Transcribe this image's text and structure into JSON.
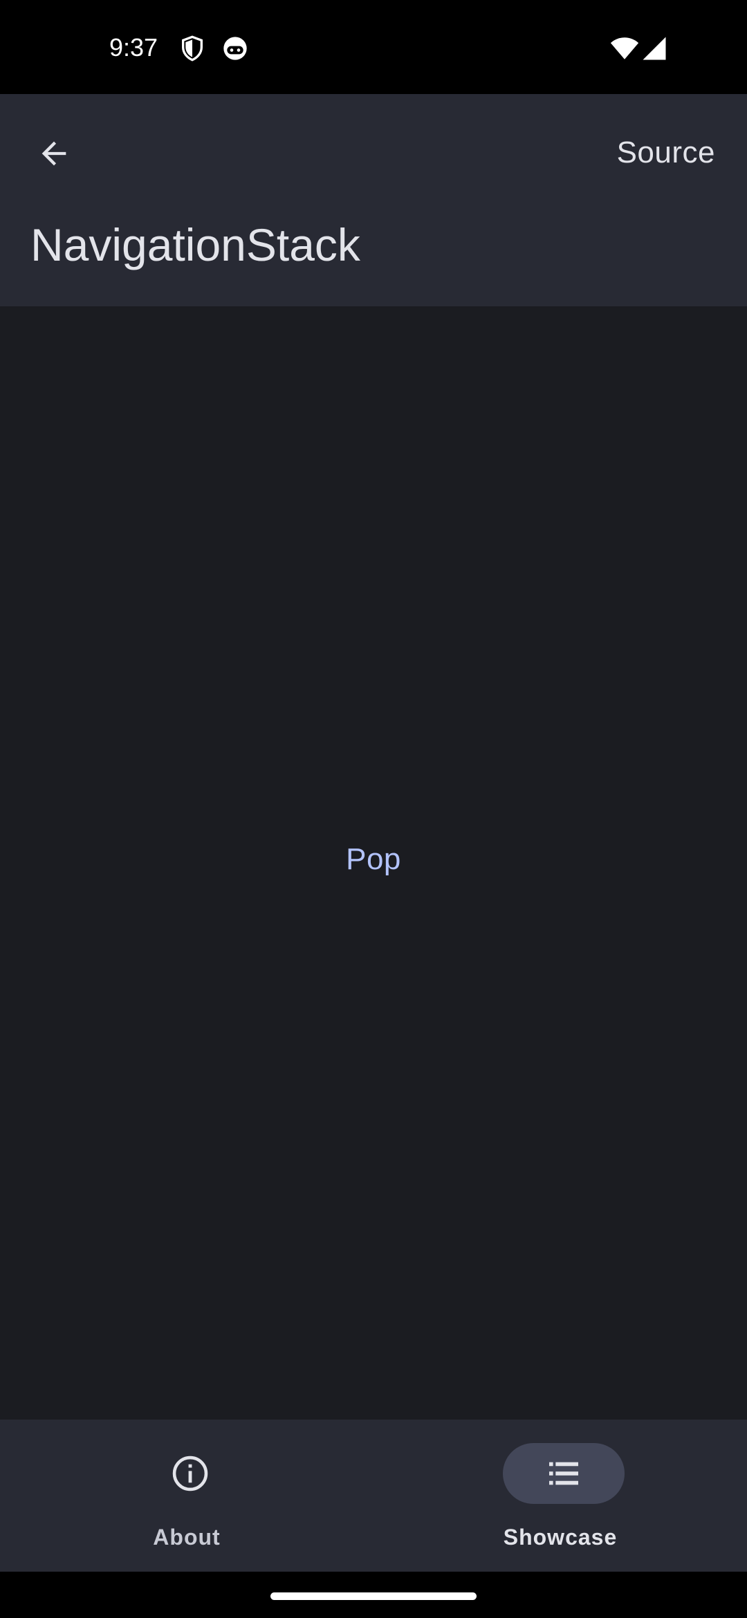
{
  "status_bar": {
    "time": "9:37",
    "left_icons": [
      "shield-icon",
      "face-icon"
    ],
    "right_icons": [
      "wifi-icon",
      "signal-icon"
    ]
  },
  "app_bar": {
    "back_icon": "arrow-back-icon",
    "action_label": "Source",
    "title": "NavigationStack"
  },
  "content": {
    "pop_label": "Pop"
  },
  "bottom_nav": {
    "items": [
      {
        "label": "About",
        "icon": "info-icon",
        "selected": false
      },
      {
        "label": "Showcase",
        "icon": "list-icon",
        "selected": true
      }
    ]
  },
  "colors": {
    "background": "#1b1c21",
    "app_bar": "#282a34",
    "accent_text": "#b3c3fb",
    "selected_pill": "#434759",
    "status_bar": "#000000"
  }
}
